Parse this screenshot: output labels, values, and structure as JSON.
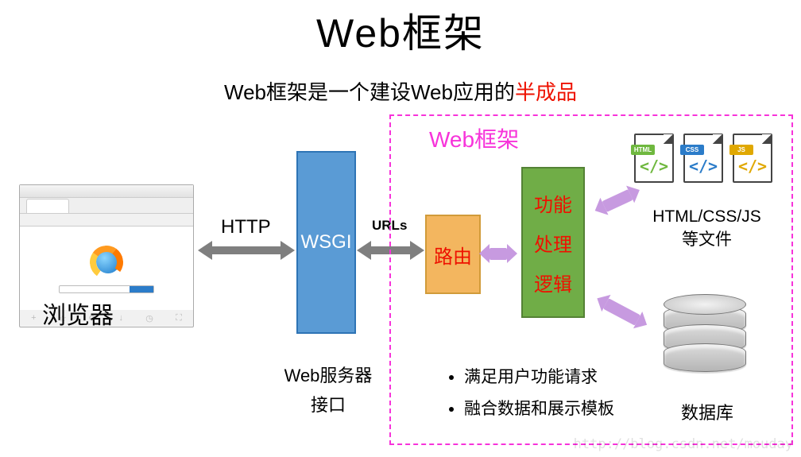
{
  "title": "Web框架",
  "subtitle_prefix": "Web框架是一个建设Web应用的",
  "subtitle_highlight": "半成品",
  "browser_label": "浏览器",
  "http_label": "HTTP",
  "wsgi_box": "WSGI",
  "wsgi_caption": "Web服务器接口",
  "urls_label": "URLs",
  "framework_title": "Web框架",
  "route_label": "路由",
  "logic_lines": {
    "l1": "功能",
    "l2": "处理",
    "l3": "逻辑"
  },
  "file_icons": {
    "html": "HTML",
    "css": "CSS",
    "js": "JS",
    "symbol": "</>"
  },
  "files_caption_line1": "HTML/CSS/JS",
  "files_caption_line2": "等文件",
  "db_caption": "数据库",
  "bullets": {
    "b1": "满足用户功能请求",
    "b2": "融合数据和展示模板"
  },
  "watermark": "http://blog.csdn.net/mouday"
}
